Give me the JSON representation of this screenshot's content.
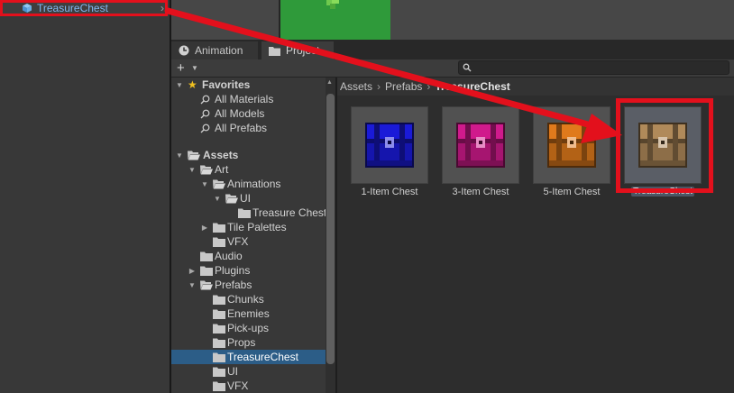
{
  "hierarchy": {
    "selected_object": "TreasureChest"
  },
  "tabs": [
    {
      "label": "Animation"
    },
    {
      "label": "Project"
    }
  ],
  "tree": {
    "favorites": {
      "label": "Favorites",
      "items": [
        "All Materials",
        "All Models",
        "All Prefabs"
      ]
    },
    "assets_label": "Assets",
    "folders": [
      {
        "label": "Art"
      },
      {
        "label": "Animations"
      },
      {
        "label": "UI"
      },
      {
        "label": "Treasure Chest"
      },
      {
        "label": "Tile Palettes"
      },
      {
        "label": "VFX"
      },
      {
        "label": "Audio"
      },
      {
        "label": "Plugins"
      },
      {
        "label": "Prefabs"
      },
      {
        "label": "Chunks"
      },
      {
        "label": "Enemies"
      },
      {
        "label": "Pick-ups"
      },
      {
        "label": "Props"
      },
      {
        "label": "TreasureChest"
      },
      {
        "label": "UI"
      },
      {
        "label": "VFX"
      }
    ]
  },
  "breadcrumb": {
    "items": [
      "Assets",
      "Prefabs"
    ],
    "current": "TreasureChest"
  },
  "assets": [
    {
      "name": "1-Item Chest",
      "color": "#1a1ad8"
    },
    {
      "name": "3-Item Chest",
      "color": "#d01a8c"
    },
    {
      "name": "5-Item Chest",
      "color": "#e07a1c"
    },
    {
      "name": "TreasureChest",
      "color": "#b08a5a"
    }
  ],
  "colors": {
    "annotation": "#e3101c",
    "selection": "#2c5d87",
    "accent_link": "#7fb7f0"
  }
}
